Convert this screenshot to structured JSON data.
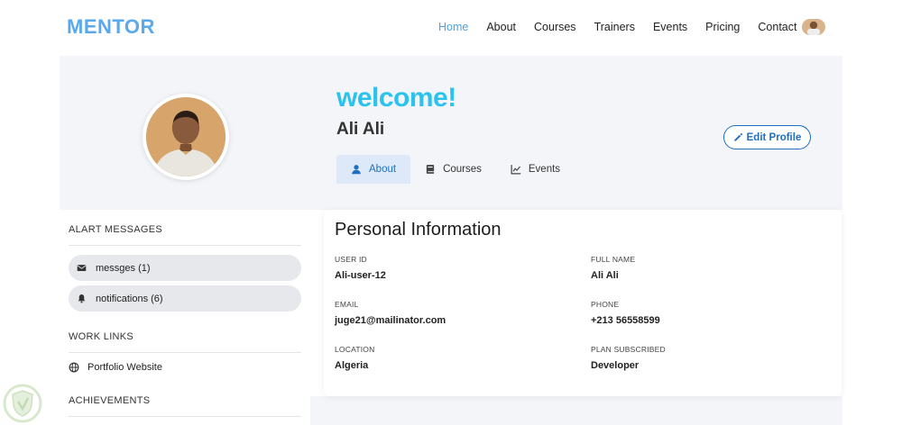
{
  "brand": {
    "name": "MENTOR"
  },
  "nav": {
    "items": [
      {
        "label": "Home",
        "active": true
      },
      {
        "label": "About"
      },
      {
        "label": "Courses"
      },
      {
        "label": "Trainers"
      },
      {
        "label": "Events"
      },
      {
        "label": "Pricing"
      },
      {
        "label": "Contact"
      }
    ]
  },
  "profile": {
    "greeting": "welcome!",
    "name": "Ali Ali",
    "edit_label": "Edit Profile"
  },
  "tabs": [
    {
      "label": "About",
      "icon": "user-icon",
      "active": true
    },
    {
      "label": "Courses",
      "icon": "book-icon"
    },
    {
      "label": "Events",
      "icon": "chart-line-icon"
    }
  ],
  "sidebar": {
    "alerts_title": "ALART MESSAGES",
    "alerts": [
      {
        "label": "messges (1)",
        "icon": "envelope-icon"
      },
      {
        "label": "notifications (6)",
        "icon": "bell-icon"
      }
    ],
    "work_links_title": "WORK LINKS",
    "work_links": [
      {
        "label": "Portfolio Website",
        "icon": "globe-icon"
      }
    ],
    "achievements_title": "ACHIEVEMENTS"
  },
  "personal_info": {
    "title": "Personal Information",
    "fields": [
      {
        "label": "USER ID",
        "value": "Ali-user-12"
      },
      {
        "label": "FULL NAME",
        "value": "Ali Ali"
      },
      {
        "label": "EMAIL",
        "value": "juge21@mailinator.com"
      },
      {
        "label": "PHONE",
        "value": "+213 56558599"
      },
      {
        "label": "LOCATION",
        "value": "Algeria"
      },
      {
        "label": "PLAN SUBSCRIBED",
        "value": "Developer"
      }
    ]
  },
  "colors": {
    "brand": "#5aa9ec",
    "welcome": "#2cc2ef",
    "accent": "#1f6fc0",
    "band_bg": "#f3f5f9"
  }
}
